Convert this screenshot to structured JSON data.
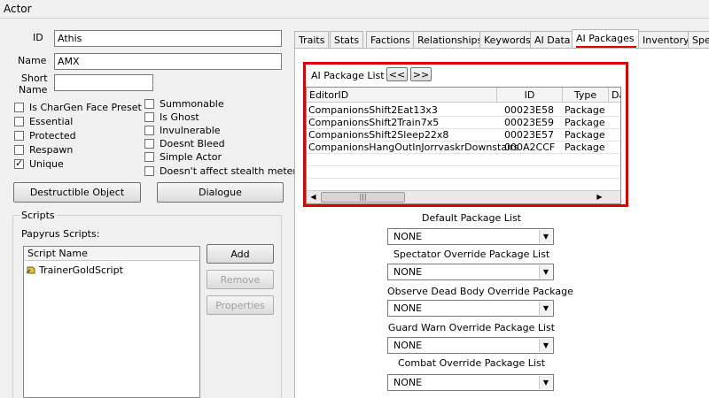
{
  "window": {
    "title": "Actor"
  },
  "fields": {
    "id_label": "ID",
    "id_value": "Athis",
    "name_label": "Name",
    "name_value": "AMX",
    "short_name_label_1": "Short",
    "short_name_label_2": "Name",
    "short_name_value": ""
  },
  "checkboxes_left": [
    {
      "label": "Is CharGen Face Preset",
      "checked": false
    },
    {
      "label": "Essential",
      "checked": false
    },
    {
      "label": "Protected",
      "checked": false
    },
    {
      "label": "Respawn",
      "checked": false
    },
    {
      "label": "Unique",
      "checked": true
    }
  ],
  "checkboxes_right": [
    {
      "label": "Summonable",
      "checked": false
    },
    {
      "label": "Is Ghost",
      "checked": false
    },
    {
      "label": "Invulnerable",
      "checked": false
    },
    {
      "label": "Doesnt Bleed",
      "checked": false
    },
    {
      "label": "Simple Actor",
      "checked": false
    },
    {
      "label": "Doesn't affect stealth meter",
      "checked": false
    }
  ],
  "buttons": {
    "destructible": "Destructible Object",
    "dialogue": "Dialogue",
    "add": "Add",
    "remove": "Remove",
    "properties": "Properties"
  },
  "scripts": {
    "group_label": "Scripts",
    "papyrus_label": "Papyrus Scripts:",
    "column_header": "Script Name",
    "items": [
      "TrainerGoldScript"
    ]
  },
  "tabs": [
    "Traits",
    "Stats",
    "Factions",
    "Relationships",
    "Keywords",
    "AI Data",
    "AI Packages",
    "Inventory",
    "Spe"
  ],
  "selected_tab": "AI Packages",
  "ai_package_list": {
    "label": "AI Package List",
    "prev_button": "<<",
    "next_button": ">>",
    "columns": [
      "EditorID",
      "ID",
      "Type",
      "Da"
    ],
    "rows": [
      {
        "editor_id": "CompanionsShift2Eat13x3",
        "id": "00023E58",
        "type": "Package"
      },
      {
        "editor_id": "CompanionsShift2Train7x5",
        "id": "00023E59",
        "type": "Package"
      },
      {
        "editor_id": "CompanionsShift2Sleep22x8",
        "id": "00023E57",
        "type": "Package"
      },
      {
        "editor_id": "CompanionsHangOutInJorrvaskrDownstairs",
        "id": "000A2CCF",
        "type": "Package"
      }
    ],
    "scroll_grip": "|||"
  },
  "override_lists": [
    {
      "label": "Default Package List",
      "value": "NONE"
    },
    {
      "label": "Spectator Override Package List",
      "value": "NONE"
    },
    {
      "label": "Observe Dead Body Override Package",
      "value": "NONE"
    },
    {
      "label": "Guard Warn Override Package List",
      "value": "NONE"
    },
    {
      "label": "Combat Override Package List",
      "value": "NONE"
    }
  ],
  "colors": {
    "highlight": "#e00000"
  }
}
